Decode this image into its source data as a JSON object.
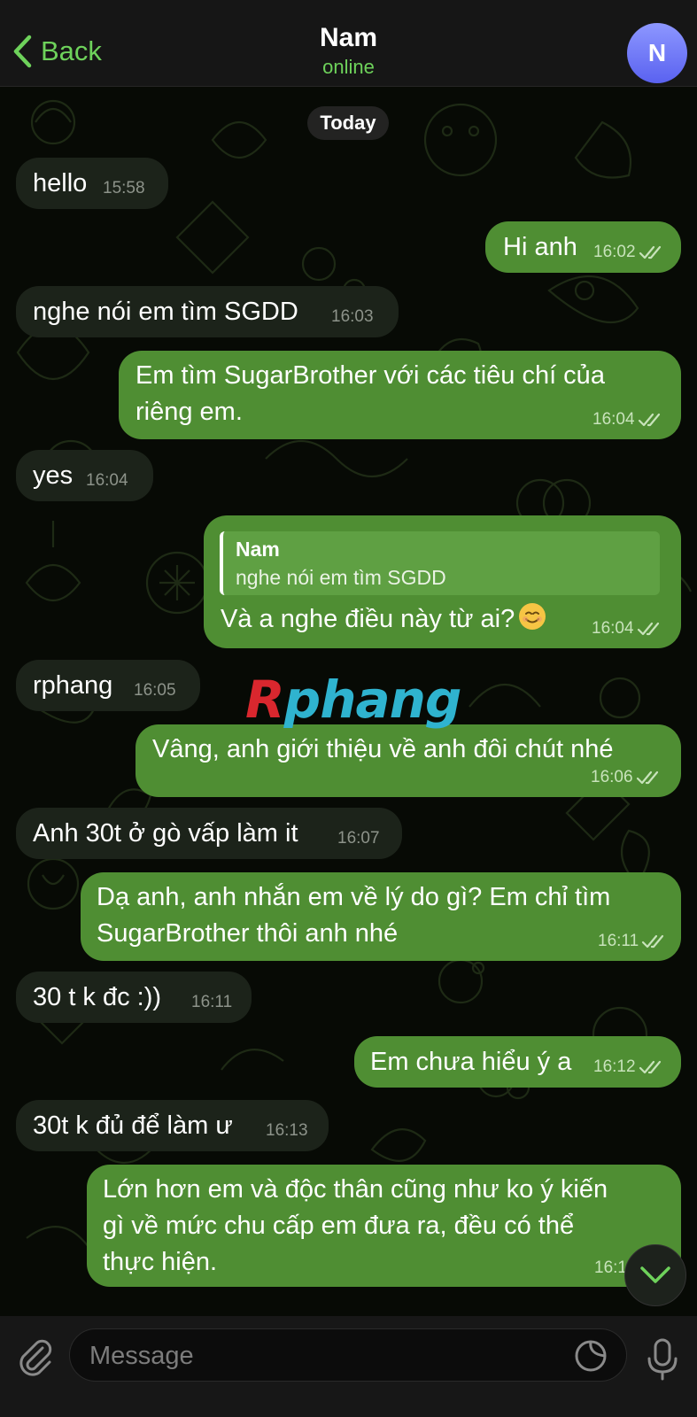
{
  "header": {
    "back_label": "Back",
    "title": "Nam",
    "status": "online",
    "avatar_initial": "N"
  },
  "date_chip": "Today",
  "messages": [
    {
      "dir": "in",
      "text": "hello",
      "time": "15:58"
    },
    {
      "dir": "out",
      "text": "Hi anh",
      "time": "16:02"
    },
    {
      "dir": "in",
      "text": "nghe nói em tìm SGDD",
      "time": "16:03"
    },
    {
      "dir": "out",
      "lines": [
        "Em tìm SugarBrother với các tiêu chí của",
        "riêng em."
      ],
      "time": "16:04"
    },
    {
      "dir": "in",
      "text": "yes",
      "time": "16:04"
    },
    {
      "dir": "out",
      "reply_name": "Nam",
      "reply_text": "nghe nói em tìm SGDD",
      "text": "Và a nghe điều này từ ai?",
      "emoji": "smiling-face",
      "time": "16:04"
    },
    {
      "dir": "in",
      "text": "rphang",
      "time": "16:05"
    },
    {
      "dir": "out",
      "text": "Vâng, anh giới thiệu về anh đôi chút nhé",
      "time": "16:06"
    },
    {
      "dir": "in",
      "text": "Anh 30t ở gò vấp làm it",
      "time": "16:07"
    },
    {
      "dir": "out",
      "lines": [
        "Dạ anh, anh nhắn em về lý do gì? Em chỉ tìm",
        "SugarBrother thôi anh nhé"
      ],
      "time": "16:11"
    },
    {
      "dir": "in",
      "text": "30 t k đc :))",
      "time": "16:11"
    },
    {
      "dir": "out",
      "text": "Em chưa hiểu ý a",
      "time": "16:12"
    },
    {
      "dir": "in",
      "text": "30t k đủ để làm ư",
      "time": "16:13"
    },
    {
      "dir": "out",
      "lines": [
        "Lớn hơn em và độc thân cũng như ko ý kiến",
        "gì về mức chu cấp em đưa ra, đều có thể",
        "thực hiện."
      ],
      "time": "16:1"
    }
  ],
  "watermark": {
    "first": "R",
    "rest": "phang"
  },
  "input": {
    "placeholder": "Message"
  },
  "colors": {
    "accent": "#6ed25b",
    "outgoing": "#4f8e33",
    "incoming": "#1c231a",
    "avatar": "#6b74f7"
  }
}
